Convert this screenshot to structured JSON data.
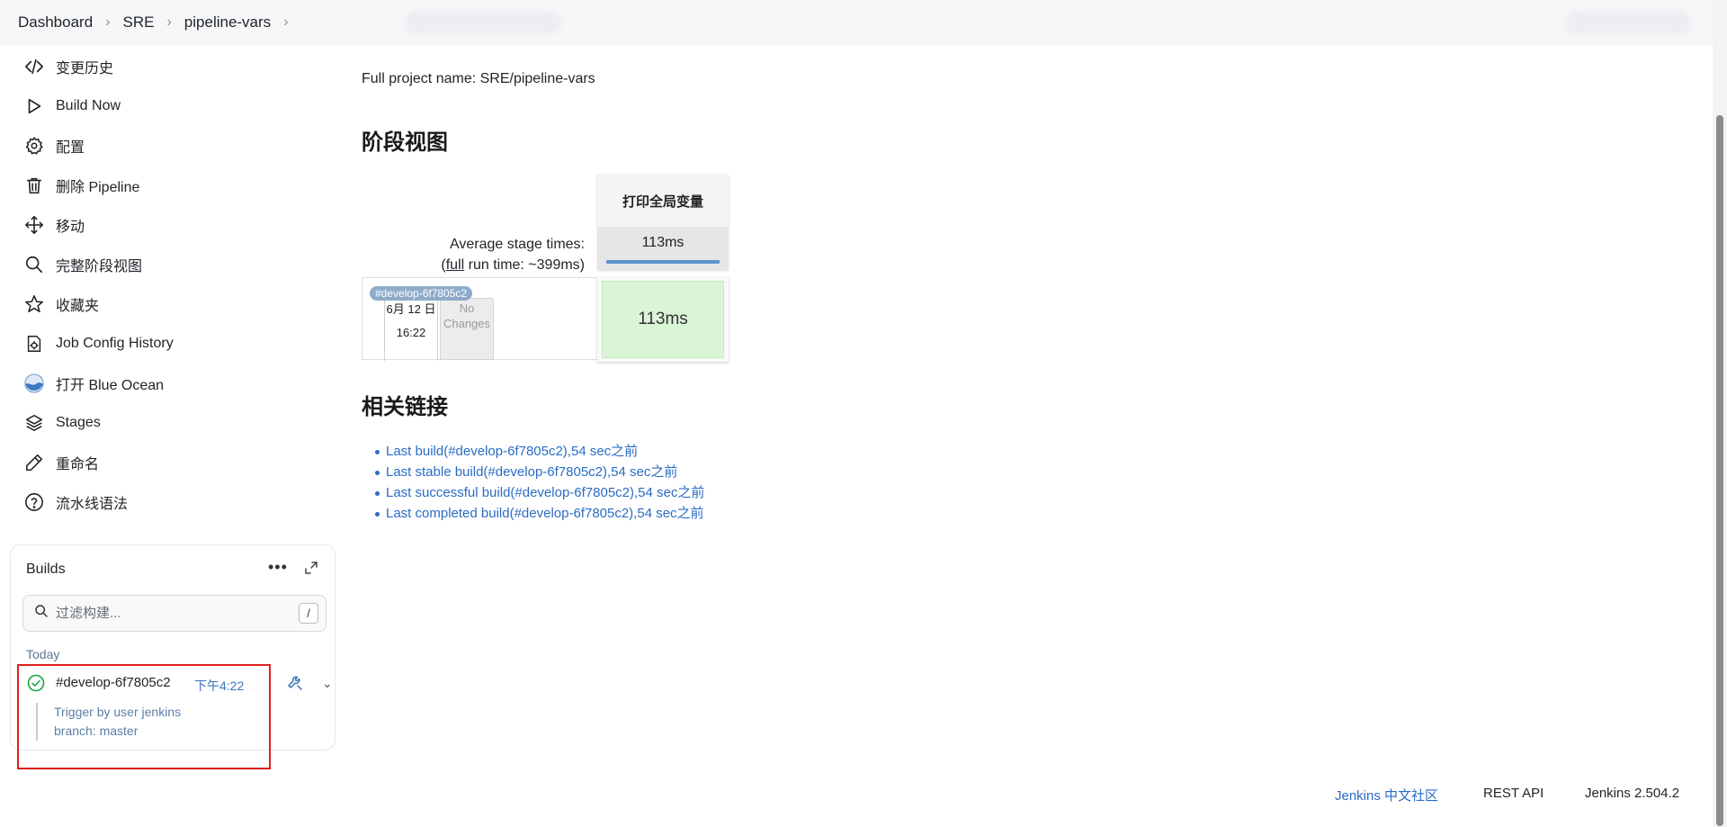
{
  "breadcrumb": [
    "Dashboard",
    "SRE",
    "pipeline-vars"
  ],
  "sidebar": {
    "items": [
      {
        "label": "变更历史",
        "icon": "code-icon"
      },
      {
        "label": "Build Now",
        "icon": "play-icon"
      },
      {
        "label": "配置",
        "icon": "gear-icon"
      },
      {
        "label": "删除 Pipeline",
        "icon": "trash-icon"
      },
      {
        "label": "移动",
        "icon": "move-icon"
      },
      {
        "label": "完整阶段视图",
        "icon": "search-icon"
      },
      {
        "label": "收藏夹",
        "icon": "star-icon"
      },
      {
        "label": "Job Config History",
        "icon": "config-history-icon"
      },
      {
        "label": "打开 Blue Ocean",
        "icon": "blue-ocean-icon"
      },
      {
        "label": "Stages",
        "icon": "layers-icon"
      },
      {
        "label": "重命名",
        "icon": "pencil-icon"
      },
      {
        "label": "流水线语法",
        "icon": "help-icon"
      }
    ]
  },
  "builds": {
    "title": "Builds",
    "more": "•••",
    "filter_placeholder": "过滤构建...",
    "shortcut": "/",
    "group": "Today",
    "items": [
      {
        "name": "#develop-6f7805c2",
        "time": "下午4:22",
        "status": "success",
        "desc_line1": "Trigger by user jenkins",
        "desc_line2": "branch: master"
      }
    ]
  },
  "main": {
    "full_project_name": "Full project name: SRE/pipeline-vars",
    "stage_view_title": "阶段视图",
    "stage_view": {
      "stage_name": "打印全局变量",
      "avg_label": "Average stage times:",
      "full_run_prefix": "(",
      "full_run_link": "full",
      "full_run_suffix": " run time: ~399ms)",
      "avg_time": "113ms",
      "build_badge": "#develop-6f7805c2",
      "build_date": "6月 12 日",
      "build_time": "16:22",
      "no_changes": "No Changes",
      "stage_time": "113ms"
    },
    "related_links_title": "相关链接",
    "related_links": [
      "Last build(#develop-6f7805c2),54 sec之前",
      "Last stable build(#develop-6f7805c2),54 sec之前",
      "Last successful build(#develop-6f7805c2),54 sec之前",
      "Last completed build(#develop-6f7805c2),54 sec之前"
    ]
  },
  "footer": {
    "community": "Jenkins 中文社区",
    "rest_api": "REST API",
    "version": "Jenkins 2.504.2"
  },
  "colors": {
    "link": "#2b6cc4",
    "success": "#1ea446",
    "stage_success_bg": "#d9f5d6",
    "highlight_border": "#e02020"
  }
}
